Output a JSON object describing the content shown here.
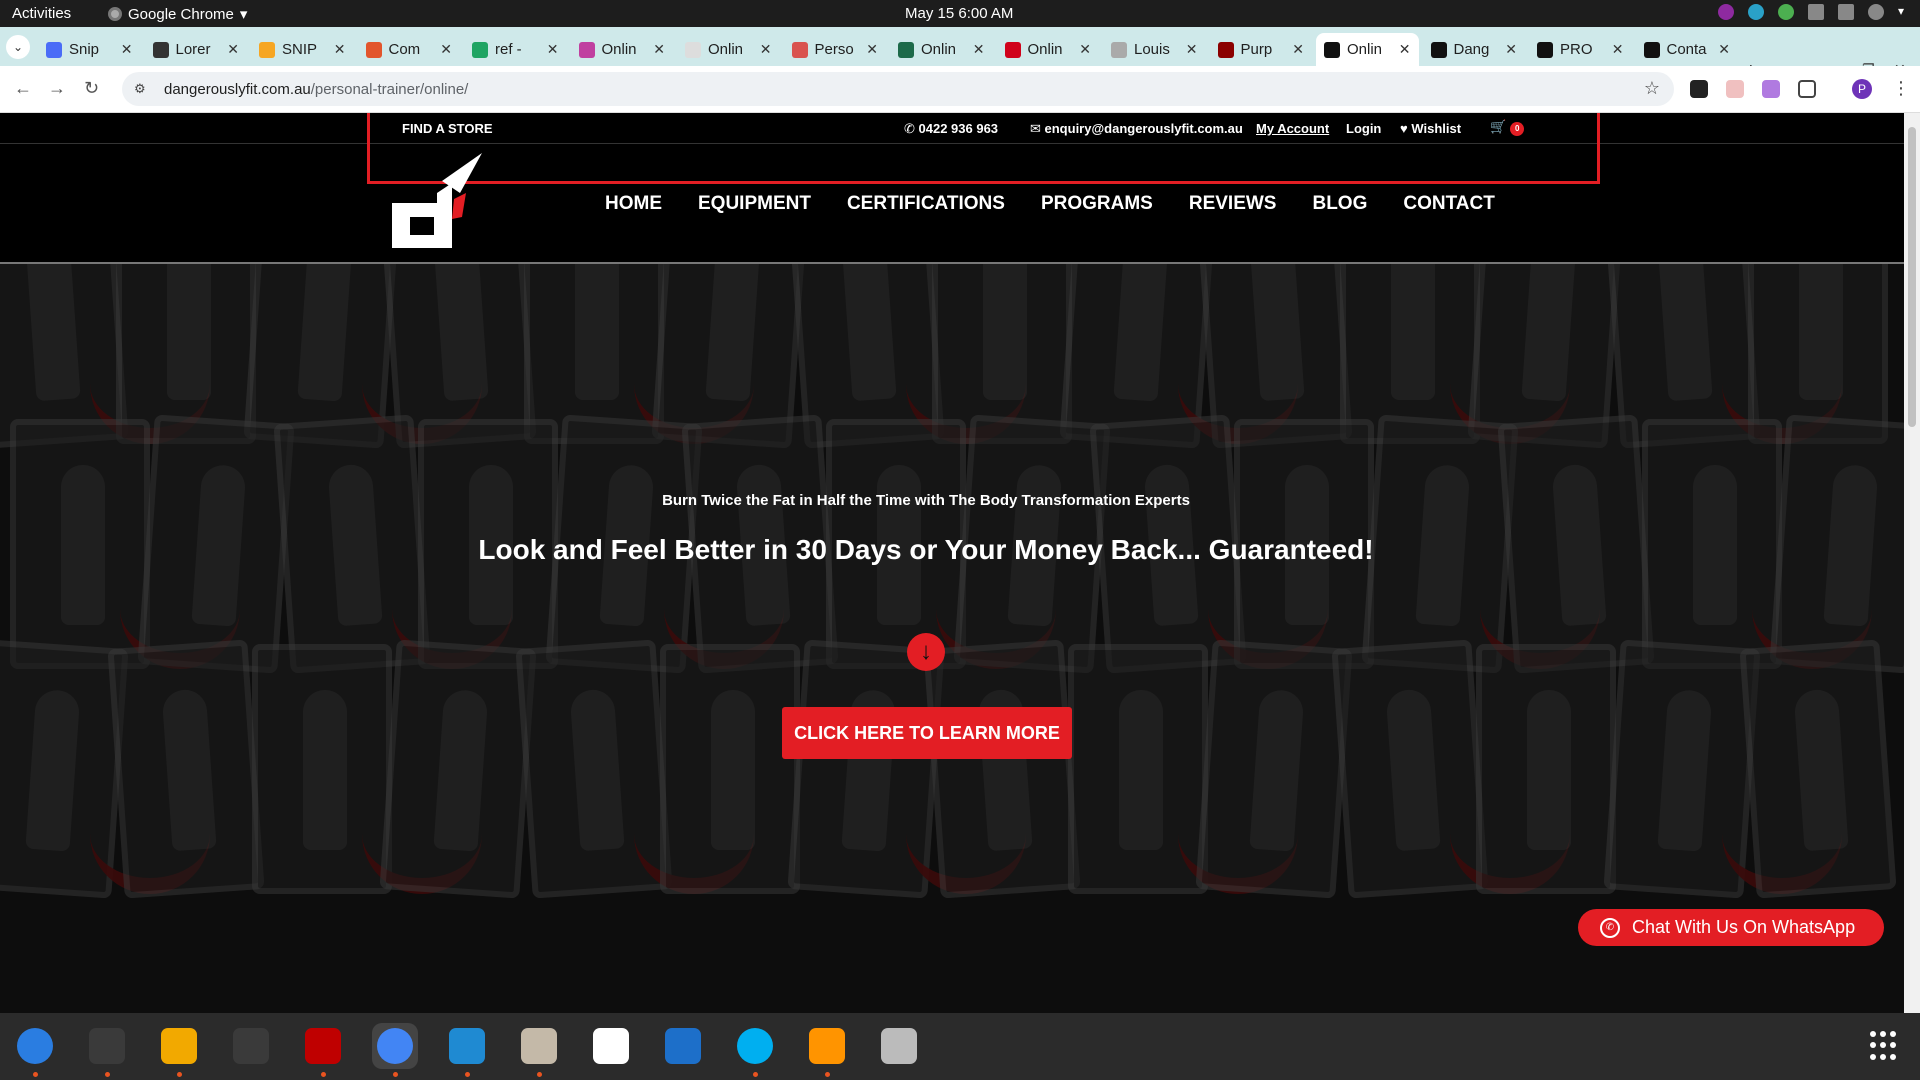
{
  "gnome": {
    "activities": "Activities",
    "app_name": "Google Chrome",
    "clock": "May 15  6:00 AM"
  },
  "browser": {
    "tabs": [
      {
        "title": "Snip",
        "favicon_color": "#4a6cf7"
      },
      {
        "title": "Lorer",
        "favicon_color": "#333333"
      },
      {
        "title": "SNIP",
        "favicon_color": "#f6a623"
      },
      {
        "title": "Com",
        "favicon_color": "#e2552c"
      },
      {
        "title": "ref -",
        "favicon_color": "#1fa463"
      },
      {
        "title": "Onlin",
        "favicon_color": "#c040a0"
      },
      {
        "title": "Onlin",
        "favicon_color": "#dddddd"
      },
      {
        "title": "Perso",
        "favicon_color": "#d9534f"
      },
      {
        "title": "Onlin",
        "favicon_color": "#1d6a4a"
      },
      {
        "title": "Onlin",
        "favicon_color": "#d0021b"
      },
      {
        "title": "Louis",
        "favicon_color": "#aaaaaa"
      },
      {
        "title": "Purp",
        "favicon_color": "#8b0000"
      },
      {
        "title": "Onlin",
        "favicon_color": "#111111",
        "active": true
      },
      {
        "title": "Dang",
        "favicon_color": "#111111"
      },
      {
        "title": "PRO",
        "favicon_color": "#111111"
      },
      {
        "title": "Conta",
        "favicon_color": "#111111"
      }
    ],
    "url_domain": "dangerouslyfit.com.au",
    "url_path": "/personal-trainer/online/",
    "profile_initial": "P"
  },
  "site": {
    "topbar": {
      "find_store": "FIND A STORE",
      "phone": "0422 936 963",
      "email": "enquiry@dangerouslyfit.com.au",
      "my_account": "My Account",
      "login": "Login",
      "wishlist": "Wishlist",
      "cart_count": "0"
    },
    "nav": [
      "HOME",
      "EQUIPMENT",
      "CERTIFICATIONS",
      "PROGRAMS",
      "REVIEWS",
      "BLOG",
      "CONTACT"
    ],
    "hero": {
      "subtitle": "Burn Twice the Fat in Half the Time with The Body Transformation Experts",
      "title": "Look and Feel Better in 30 Days or Your Money Back... Guaranteed!",
      "cta": "CLICK HERE TO LEARN MORE"
    },
    "whatsapp": "Chat With Us On WhatsApp",
    "accent_color": "#e31e24"
  },
  "dock": {
    "apps": [
      {
        "name": "thunderbird-icon",
        "color": "#2a7de1",
        "running": true
      },
      {
        "name": "terminal-icon",
        "color": "#3a3a3a",
        "running": true
      },
      {
        "name": "calculator-icon",
        "color": "#f2a900",
        "running": true
      },
      {
        "name": "system-monitor-icon",
        "color": "#3a3a3a",
        "running": false
      },
      {
        "name": "filezilla-icon",
        "color": "#bf0000",
        "running": true
      },
      {
        "name": "chrome-icon",
        "color": "#4285f4",
        "running": true,
        "active": true
      },
      {
        "name": "vscode-icon",
        "color": "#1f8ad2",
        "running": true
      },
      {
        "name": "files-icon",
        "color": "#c4b9a8",
        "running": true
      },
      {
        "name": "text-editor-icon",
        "color": "#ffffff",
        "running": false
      },
      {
        "name": "libreoffice-writer-icon",
        "color": "#1d6fc9",
        "running": false
      },
      {
        "name": "skype-icon",
        "color": "#00aff0",
        "running": true
      },
      {
        "name": "firefox-dev-icon",
        "color": "#ff9400",
        "running": true
      },
      {
        "name": "disk-utility-icon",
        "color": "#bbbbbb",
        "running": false
      }
    ]
  }
}
